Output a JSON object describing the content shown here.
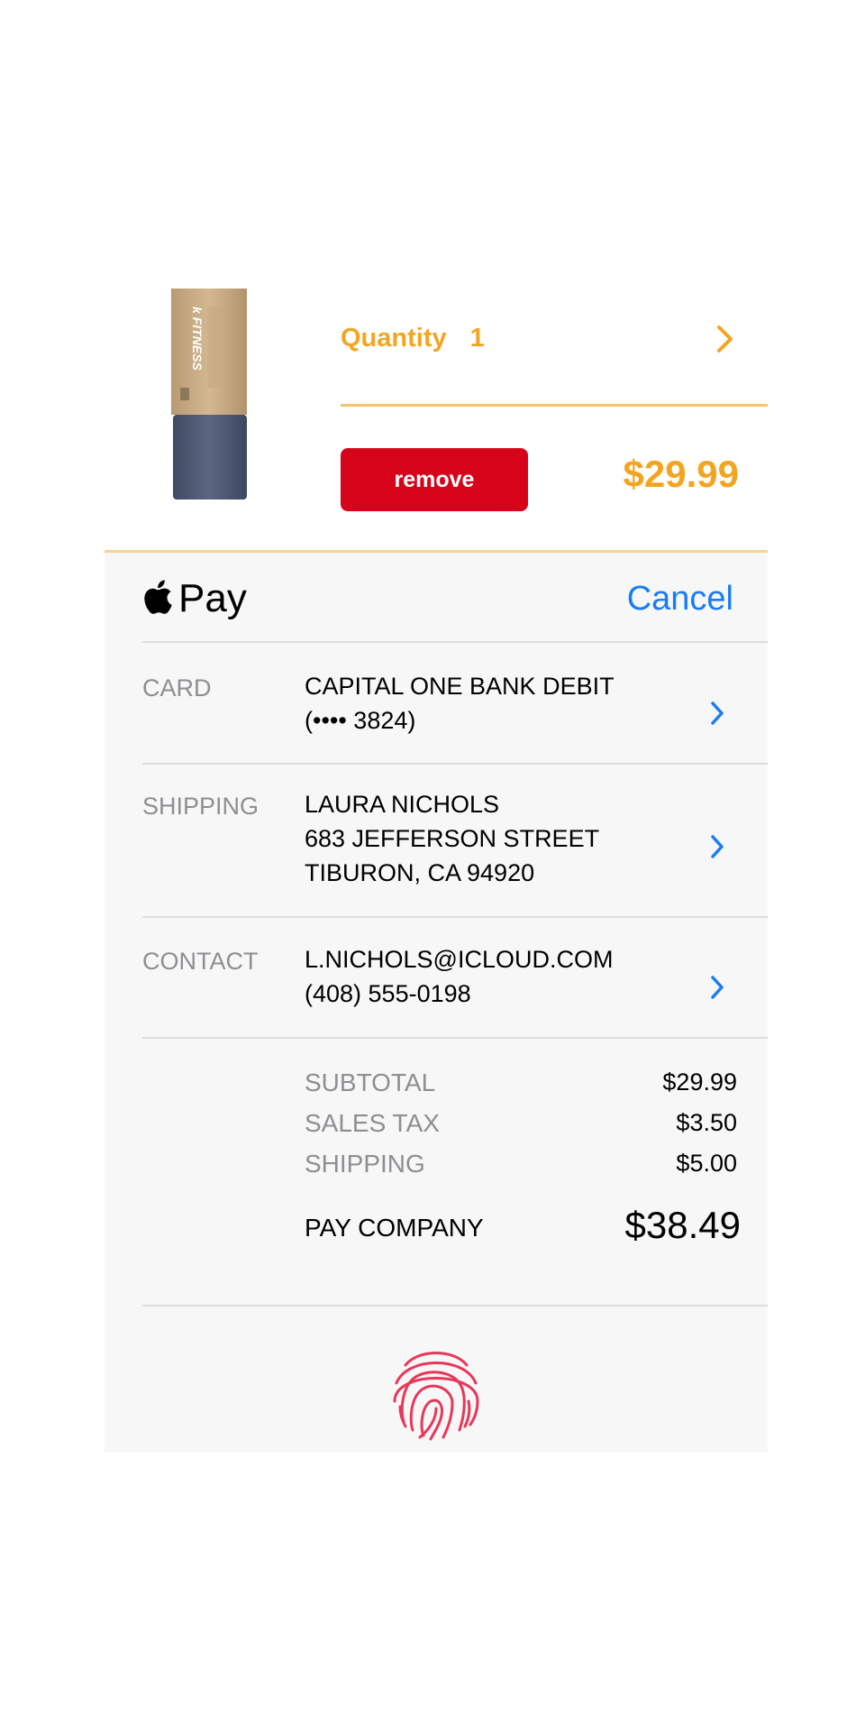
{
  "product": {
    "image_icon": "fitness-roll-product-image",
    "quantity_label": "Quantity",
    "quantity_value": "1",
    "remove_label": "remove",
    "price": "$29.99"
  },
  "pay_sheet": {
    "logo_text": "Pay",
    "cancel_label": "Cancel",
    "card": {
      "label": "CARD",
      "line1": "CAPITAL ONE BANK DEBIT",
      "line2": "(•••• 3824)"
    },
    "shipping": {
      "label": "SHIPPING",
      "line1": "LAURA NICHOLS",
      "line2": "683 JEFFERSON STREET",
      "line3": "TIBURON, CA 94920"
    },
    "contact": {
      "label": "CONTACT",
      "line1": "L.NICHOLS@ICLOUD.COM",
      "line2": "(408) 555-0198"
    },
    "summary": {
      "subtotal_label": "SUBTOTAL",
      "subtotal_value": "$29.99",
      "tax_label": "SALES TAX",
      "tax_value": "$3.50",
      "shipping_label": "SHIPPING",
      "shipping_value": "$5.00",
      "total_label": "PAY COMPANY",
      "total_value": "$38.49"
    },
    "fingerprint_icon": "touch-id-fingerprint-icon"
  },
  "colors": {
    "accent_orange": "#f3a521",
    "remove_red": "#d6041a",
    "link_blue": "#1a7cf5",
    "fingerprint_pink": "#e8375a",
    "sheet_bg": "#f7f7f7"
  }
}
